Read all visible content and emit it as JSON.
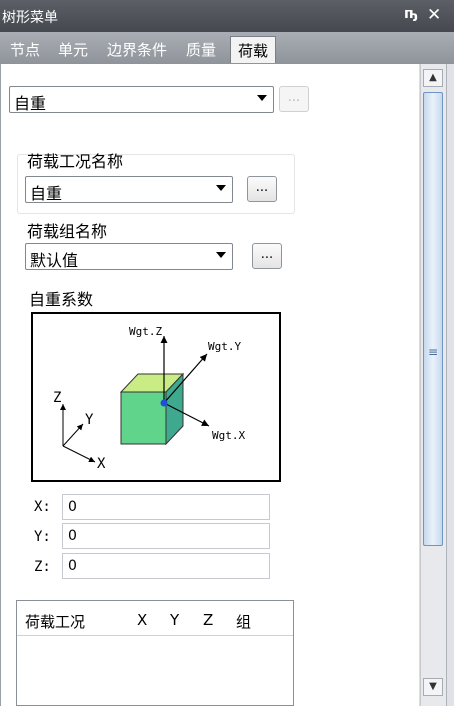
{
  "window": {
    "title": "树形菜单",
    "pin_icon": "pin-icon",
    "close_icon": "close-icon"
  },
  "tabs": [
    {
      "label": "节点"
    },
    {
      "label": "单元"
    },
    {
      "label": "边界条件"
    },
    {
      "label": "质量"
    },
    {
      "label": "荷载",
      "active": true
    }
  ],
  "load_type": {
    "value": "自重",
    "more_label": "..."
  },
  "load_case": {
    "label": "荷载工况名称",
    "value": "自重",
    "more_label": "..."
  },
  "load_group": {
    "label": "荷载组名称",
    "value": "默认值",
    "more_label": "..."
  },
  "self_weight": {
    "label": "自重系数",
    "diagram": {
      "labels": {
        "wgt_z": "Wgt.Z",
        "wgt_y": "Wgt.Y",
        "wgt_x": "Wgt.X",
        "axis_z": "Z",
        "axis_y": "Y",
        "axis_x": "X"
      },
      "cube_colors": {
        "front": "#5fd48a",
        "top": "#c9ec84",
        "side": "#3fa98f"
      }
    },
    "fields": [
      {
        "label": "X:",
        "value": "0"
      },
      {
        "label": "Y:",
        "value": "0"
      },
      {
        "label": "Z:",
        "value": "0"
      }
    ]
  },
  "table": {
    "columns": [
      "荷载工况",
      "X",
      "Y",
      "Z",
      "组"
    ],
    "rows": []
  },
  "scrollbar": {
    "up_icon": "scroll-up-arrow-icon",
    "down_icon": "scroll-down-arrow-icon",
    "grip_icon": "scroll-grip-icon"
  }
}
